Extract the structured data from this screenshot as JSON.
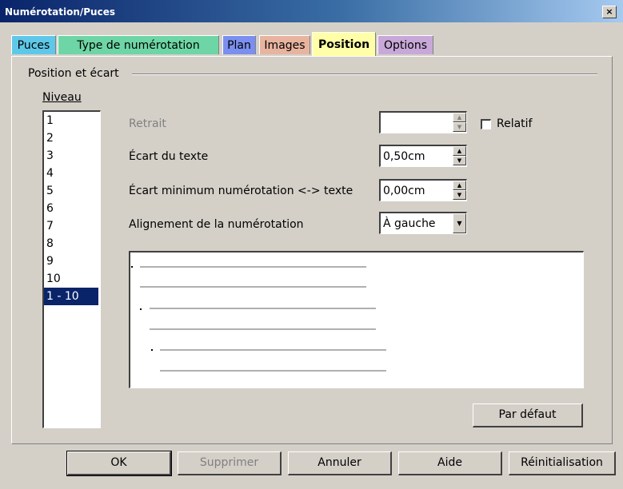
{
  "window": {
    "title": "Numérotation/Puces",
    "close_label": "×"
  },
  "tabs": [
    {
      "label": "Puces",
      "color": "#5fc8e8"
    },
    {
      "label": "Type de numérotation",
      "color": "#6ed6a6"
    },
    {
      "label": "Plan",
      "color": "#7b8ff0"
    },
    {
      "label": "Images",
      "color": "#e8b4a0"
    },
    {
      "label": "Position",
      "color": "#ffffa8",
      "active": true
    },
    {
      "label": "Options",
      "color": "#c8a8d8"
    }
  ],
  "group": {
    "title": "Position et écart"
  },
  "niveau": {
    "label": "Niveau",
    "items": [
      "1",
      "2",
      "3",
      "4",
      "5",
      "6",
      "7",
      "8",
      "9",
      "10",
      "1 - 10"
    ],
    "selected": "1 - 10"
  },
  "fields": {
    "retrait": {
      "label": "Retrait",
      "value": "",
      "disabled": true
    },
    "relatif": {
      "label": "Relatif",
      "checked": false
    },
    "ecart_texte": {
      "label": "Écart du texte",
      "value": "0,50cm"
    },
    "ecart_min": {
      "label": "Écart minimum numérotation <-> texte",
      "value": "0,00cm"
    },
    "alignement": {
      "label": "Alignement de la numérotation",
      "value": "À gauche"
    }
  },
  "buttons": {
    "par_defaut": "Par défaut",
    "ok": "OK",
    "supprimer": "Supprimer",
    "annuler": "Annuler",
    "aide": "Aide",
    "reinit": "Réinitialisation"
  },
  "icons": {
    "spin_up": "▲",
    "spin_down": "▼",
    "dropdown": "▼"
  }
}
